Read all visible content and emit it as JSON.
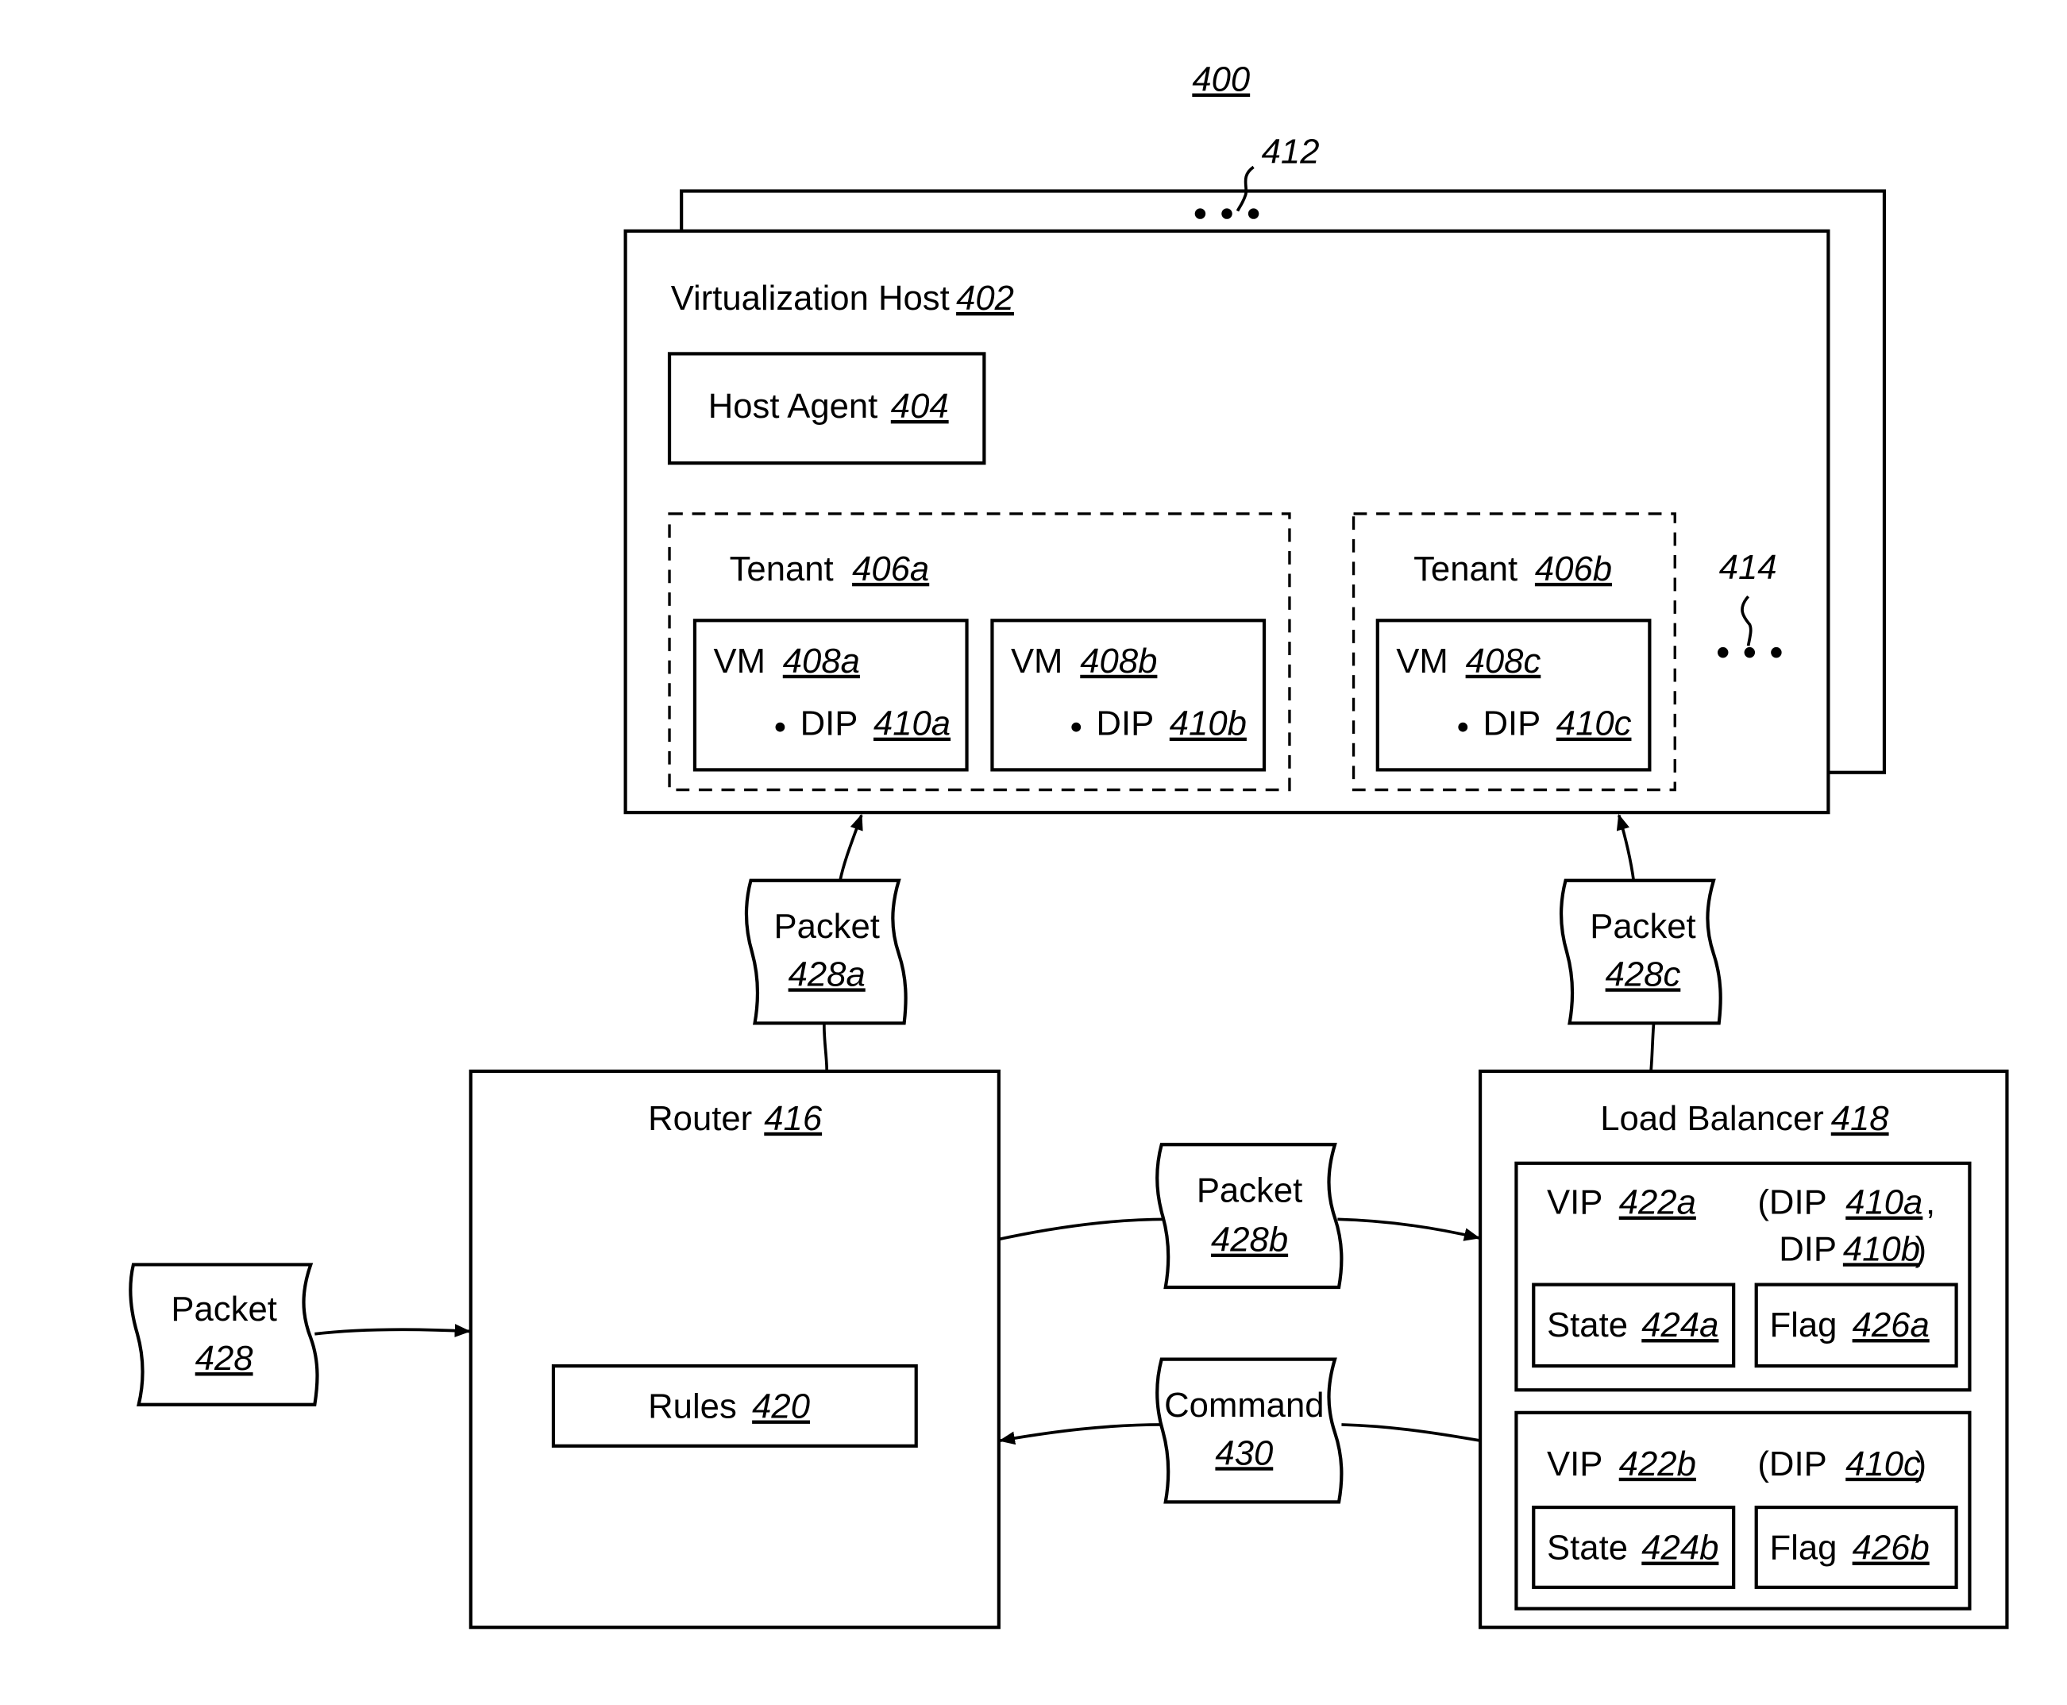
{
  "figure": {
    "ref": "400"
  },
  "host": {
    "title": "Virtualization Host",
    "ref": "402",
    "stack_ref": "412"
  },
  "host_agent": {
    "title": "Host Agent",
    "ref": "404"
  },
  "tenants": [
    {
      "title": "Tenant",
      "ref": "406a",
      "vms": [
        {
          "title": "VM",
          "ref": "408a",
          "dip_label": "DIP",
          "dip_ref": "410a"
        },
        {
          "title": "VM",
          "ref": "408b",
          "dip_label": "DIP",
          "dip_ref": "410b"
        }
      ]
    },
    {
      "title": "Tenant",
      "ref": "406b",
      "vms": [
        {
          "title": "VM",
          "ref": "408c",
          "dip_label": "DIP",
          "dip_ref": "410c"
        }
      ]
    }
  ],
  "more_tenants_ref": "414",
  "router": {
    "title": "Router",
    "ref": "416",
    "rules_title": "Rules",
    "rules_ref": "420"
  },
  "load_balancer": {
    "title": "Load Balancer",
    "ref": "418",
    "vips": [
      {
        "title": "VIP",
        "ref": "422a",
        "dips_text": "(DIP",
        "dip1_ref": "410a",
        "dip2_label": "DIP",
        "dip2_ref": "410b",
        "state_title": "State",
        "state_ref": "424a",
        "flag_title": "Flag",
        "flag_ref": "426a"
      },
      {
        "title": "VIP",
        "ref": "422b",
        "dips_text": "(DIP",
        "dip1_ref": "410c",
        "state_title": "State",
        "state_ref": "424b",
        "flag_title": "Flag",
        "flag_ref": "426b"
      }
    ]
  },
  "messages": {
    "packet_in": {
      "title": "Packet",
      "ref": "428"
    },
    "packet_a": {
      "title": "Packet",
      "ref": "428a"
    },
    "packet_b": {
      "title": "Packet",
      "ref": "428b"
    },
    "packet_c": {
      "title": "Packet",
      "ref": "428c"
    },
    "command": {
      "title": "Command",
      "ref": "430"
    }
  },
  "punct": {
    "comma": ",",
    "close_paren": ")"
  }
}
